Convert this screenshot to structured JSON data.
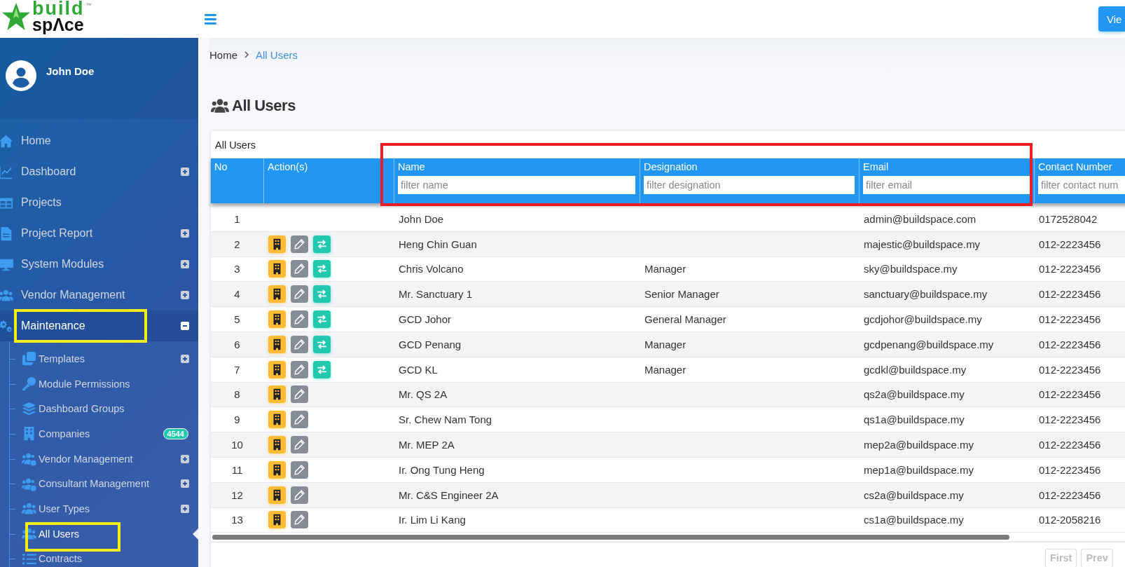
{
  "logo": {
    "word1": "build",
    "word2": "spΛce",
    "mark": "™"
  },
  "topbar": {
    "view_button": "Vie"
  },
  "user": {
    "name": "John Doe"
  },
  "sidebar": {
    "items": [
      {
        "label": "Home",
        "selected": false
      },
      {
        "label": "Dashboard",
        "expanded": false,
        "selected": false
      },
      {
        "label": "Projects",
        "selected": false
      },
      {
        "label": "Project Report",
        "expanded": false,
        "selected": false
      },
      {
        "label": "System Modules",
        "expanded": false,
        "selected": false
      },
      {
        "label": "Vendor Management",
        "expanded": false,
        "selected": false
      },
      {
        "label": "Maintenance",
        "expanded": true,
        "selected": false,
        "highlighted": true,
        "children": [
          {
            "label": "Templates",
            "expanded": false,
            "selected": false
          },
          {
            "label": "Module Permissions",
            "selected": false
          },
          {
            "label": "Dashboard Groups",
            "selected": false
          },
          {
            "label": "Companies",
            "selected": false,
            "badge": "4544"
          },
          {
            "label": "Vendor Management",
            "expanded": false,
            "selected": false
          },
          {
            "label": "Consultant Management",
            "expanded": false,
            "selected": false
          },
          {
            "label": "User Types",
            "expanded": false,
            "selected": false
          },
          {
            "label": "All Users",
            "selected": true,
            "highlighted": true
          },
          {
            "label": "Contracts",
            "selected": false
          }
        ]
      }
    ]
  },
  "breadcrumb": [
    {
      "label": "Home",
      "current": false
    },
    {
      "label": "All Users",
      "current": true
    }
  ],
  "page_title": "All Users",
  "table": {
    "title": "All Users",
    "filters_highlighted": true,
    "columns": [
      {
        "label": "No"
      },
      {
        "label": "Action(s)"
      },
      {
        "label": "Name",
        "placeholder": "filter name"
      },
      {
        "label": "Designation",
        "placeholder": "filter designation"
      },
      {
        "label": "Email",
        "placeholder": "filter email"
      },
      {
        "label": "Contact Number",
        "placeholder": "filter contact num"
      }
    ],
    "rows": [
      {
        "no": "1",
        "name": "John Doe",
        "email": "admin@buildspace.com",
        "contact": "0172528042"
      },
      {
        "no": "2",
        "actions": [
          {
            "kind": "company"
          },
          {
            "kind": "edit"
          },
          {
            "kind": "switch"
          }
        ],
        "name": "Heng Chin Guan",
        "email": "majestic@buildspace.my",
        "contact": "012-2223456"
      },
      {
        "no": "3",
        "actions": [
          {
            "kind": "company"
          },
          {
            "kind": "edit"
          },
          {
            "kind": "switch"
          }
        ],
        "name": "Chris Volcano",
        "designation": "Manager",
        "email": "sky@buildspace.my",
        "contact": "012-2223456"
      },
      {
        "no": "4",
        "actions": [
          {
            "kind": "company"
          },
          {
            "kind": "edit"
          },
          {
            "kind": "switch"
          }
        ],
        "name": "Mr. Sanctuary 1",
        "designation": "Senior Manager",
        "email": "sanctuary@buildspace.my",
        "contact": "012-2223456"
      },
      {
        "no": "5",
        "actions": [
          {
            "kind": "company"
          },
          {
            "kind": "edit"
          },
          {
            "kind": "switch"
          }
        ],
        "name": "GCD Johor",
        "designation": "General Manager",
        "email": "gcdjohor@buildspace.my",
        "contact": "012-2223456"
      },
      {
        "no": "6",
        "actions": [
          {
            "kind": "company"
          },
          {
            "kind": "edit"
          },
          {
            "kind": "switch"
          }
        ],
        "name": "GCD Penang",
        "designation": "Manager",
        "email": "gcdpenang@buildspace.my",
        "contact": "012-2223456"
      },
      {
        "no": "7",
        "actions": [
          {
            "kind": "company"
          },
          {
            "kind": "edit"
          },
          {
            "kind": "switch"
          }
        ],
        "name": "GCD KL",
        "designation": "Manager",
        "email": "gcdkl@buildspace.my",
        "contact": "012-2223456"
      },
      {
        "no": "8",
        "actions": [
          {
            "kind": "company"
          },
          {
            "kind": "edit"
          }
        ],
        "name": "Mr. QS 2A",
        "email": "qs2a@buildspace.my",
        "contact": "012-2223456"
      },
      {
        "no": "9",
        "actions": [
          {
            "kind": "company"
          },
          {
            "kind": "edit"
          }
        ],
        "name": "Sr. Chew Nam Tong",
        "email": "qs1a@buildspace.my",
        "contact": "012-2223456"
      },
      {
        "no": "10",
        "actions": [
          {
            "kind": "company"
          },
          {
            "kind": "edit"
          }
        ],
        "name": "Mr. MEP 2A",
        "email": "mep2a@buildspace.my",
        "contact": "012-2223456"
      },
      {
        "no": "11",
        "actions": [
          {
            "kind": "company"
          },
          {
            "kind": "edit"
          }
        ],
        "name": "Ir. Ong Tung Heng",
        "email": "mep1a@buildspace.my",
        "contact": "012-2223456"
      },
      {
        "no": "12",
        "actions": [
          {
            "kind": "company"
          },
          {
            "kind": "edit"
          }
        ],
        "name": "Mr. C&S Engineer 2A",
        "email": "cs2a@buildspace.my",
        "contact": "012-2223456"
      },
      {
        "no": "13",
        "actions": [
          {
            "kind": "company"
          },
          {
            "kind": "edit"
          }
        ],
        "name": "Ir. Lim Li Kang",
        "email": "cs1a@buildspace.my",
        "contact": "012-2058216"
      }
    ]
  },
  "pagination": [
    {
      "label": "First",
      "disabled": true
    },
    {
      "label": "Prev",
      "disabled": true
    }
  ]
}
